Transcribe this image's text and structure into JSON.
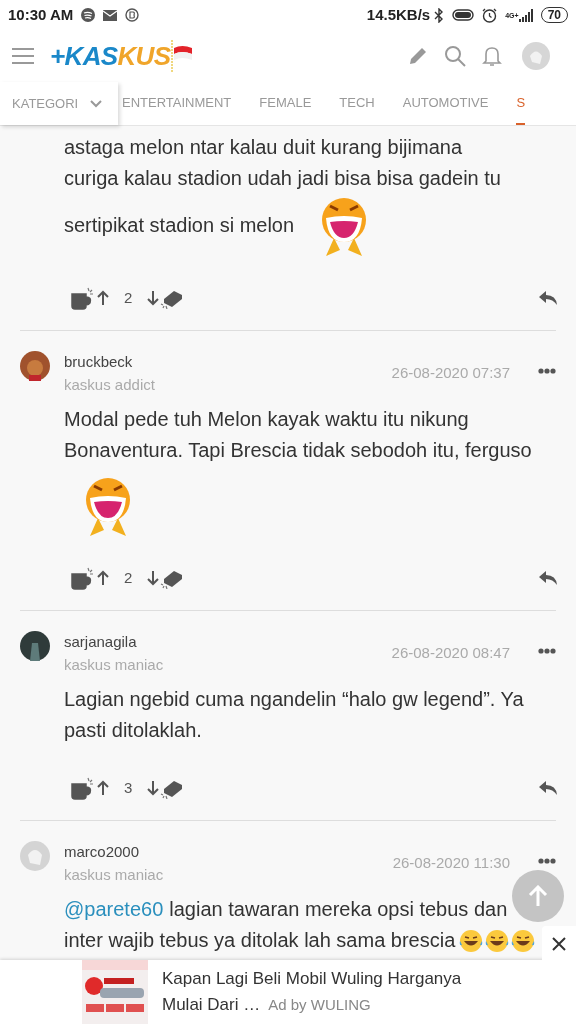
{
  "status_bar": {
    "time": "10:30 AM",
    "speed": "14.5KB/s",
    "network": "4G+",
    "battery": "70"
  },
  "header": {
    "logo_blue": "+KAS",
    "logo_yellow": "KUS"
  },
  "tabs": [
    {
      "label": "KATEGORI",
      "kind": "dropdown",
      "selected": false
    },
    {
      "label": "ENTERTAINMENT",
      "kind": "tab",
      "selected": false
    },
    {
      "label": "FEMALE",
      "kind": "tab",
      "selected": false
    },
    {
      "label": "TECH",
      "kind": "tab",
      "selected": false
    },
    {
      "label": "AUTOMOTIVE",
      "kind": "tab",
      "selected": false
    },
    {
      "label": "S",
      "kind": "tab",
      "selected": true
    }
  ],
  "posts": [
    {
      "lines": [
        {
          "text": "astaga melon ntar kalau duit kurang bijimana"
        },
        {
          "text": "curiga kalau stadion udah jadi bisa bisa gadein tu"
        },
        {
          "text": "sertipikat stadion si melon",
          "sticker": true
        }
      ],
      "votes": "2"
    },
    {
      "author": "bruckbeck",
      "rank": "kaskus addict",
      "date": "26-08-2020 07:37",
      "lines": [
        {
          "text": "Modal pede tuh Melon kayak waktu itu nikung"
        },
        {
          "text": "Bonaventura. Tapi Brescia tidak sebodoh itu, ferguso"
        }
      ],
      "sticker_below": true,
      "votes": "2"
    },
    {
      "author": "sarjanagila",
      "rank": "kaskus maniac",
      "date": "26-08-2020 08:47",
      "lines": [
        {
          "text": "Lagian ngebid cuma ngandelin “halo gw legend”. Ya"
        },
        {
          "text": "pasti ditolaklah."
        }
      ],
      "votes": "3"
    },
    {
      "author": "marco2000",
      "rank": "kaskus maniac",
      "date": "26-08-2020 11:30",
      "mention": "@parete60",
      "lines": [
        {
          "text": "lagian tawaran mereka opsi tebus dan"
        },
        {
          "text": "inter wajib tebus ya ditolak lah sama brescia",
          "emojis": [
            {
              "kind": "laugh"
            },
            {
              "kind": "laugh"
            },
            {
              "kind": "laugh"
            }
          ]
        }
      ]
    }
  ],
  "ad": {
    "title": "Kapan Lagi Beli Mobil Wuling Harganya",
    "title2": "Mulai Dari …",
    "by": "Ad by WULING"
  }
}
